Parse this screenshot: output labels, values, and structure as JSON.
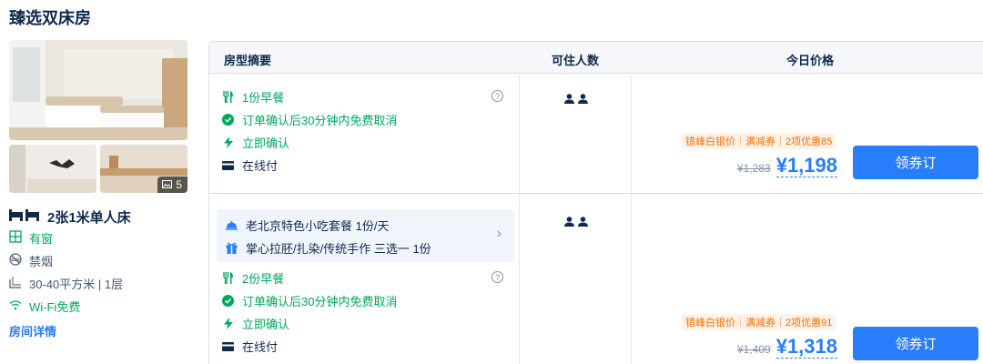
{
  "room": {
    "title": "臻选双床房",
    "photo_count": "5",
    "bed": "2张1米单人床",
    "features": [
      {
        "icon": "window-icon",
        "label": "有窗"
      },
      {
        "icon": "no-smoking-icon",
        "label": "禁烟"
      },
      {
        "icon": "area-icon",
        "label": "30-40平方米 | 1层"
      },
      {
        "icon": "wifi-icon",
        "label": "Wi-Fi免费"
      }
    ],
    "detail_link": "房间详情"
  },
  "table": {
    "headers": [
      "房型摘要",
      "可住人数",
      "今日价格"
    ]
  },
  "offers": [
    {
      "perks": [
        {
          "icon": "fork-knife-icon",
          "label": "1份早餐",
          "color": "#00a85a"
        },
        {
          "icon": "check-circle-icon",
          "label": "订单确认后30分钟内免费取消",
          "color": "#00a85a"
        },
        {
          "icon": "lightning-icon",
          "label": "立即确认",
          "color": "#00a85a"
        },
        {
          "icon": "card-icon",
          "label": "在线付",
          "color": "#0f294d"
        }
      ],
      "occupancy": 2,
      "promo_tags": [
        "错峰白银价",
        "满减券",
        "2项优惠85"
      ],
      "old_price": "¥1,283",
      "price": "¥1,198",
      "button": "领券订"
    },
    {
      "package": [
        {
          "icon": "cloche-icon",
          "label": "老北京特色小吃套餐 1份/天"
        },
        {
          "icon": "gift-icon",
          "label": "掌心拉胚/扎染/传统手作 三选一 1份"
        }
      ],
      "perks": [
        {
          "icon": "fork-knife-icon",
          "label": "2份早餐",
          "color": "#00a85a"
        },
        {
          "icon": "check-circle-icon",
          "label": "订单确认后30分钟内免费取消",
          "color": "#00a85a"
        },
        {
          "icon": "lightning-icon",
          "label": "立即确认",
          "color": "#00a85a"
        },
        {
          "icon": "card-icon",
          "label": "在线付",
          "color": "#0f294d"
        }
      ],
      "occupancy": 2,
      "promo_tags": [
        "错峰白银价",
        "满减券",
        "2项优惠91"
      ],
      "old_price": "¥1,409",
      "price": "¥1,318",
      "button": "领券订"
    }
  ],
  "colors": {
    "brand": "#287dfa",
    "green": "#00a85a",
    "promo": "#ff6f00",
    "text": "#0f294d"
  }
}
